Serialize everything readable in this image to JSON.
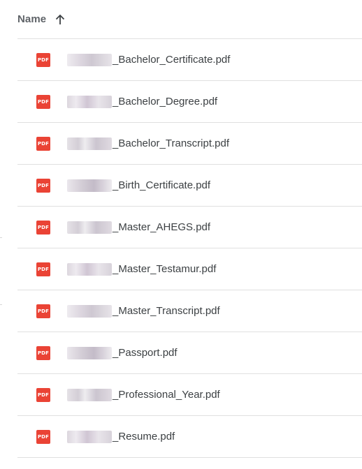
{
  "header": {
    "name_label": "Name",
    "sort_icon": "arrow-up-icon"
  },
  "colors": {
    "pdf_icon": "#ea4335",
    "text": "#3c4043",
    "header_text": "#5f6368",
    "divider": "#e0e0e0"
  },
  "files": [
    {
      "name": "_Bachelor_Certificate.pdf",
      "icon": "pdf-icon",
      "icon_text": "PDF"
    },
    {
      "name": "_Bachelor_Degree.pdf",
      "icon": "pdf-icon",
      "icon_text": "PDF"
    },
    {
      "name": "_Bachelor_Transcript.pdf",
      "icon": "pdf-icon",
      "icon_text": "PDF"
    },
    {
      "name": "_Birth_Certificate.pdf",
      "icon": "pdf-icon",
      "icon_text": "PDF"
    },
    {
      "name": "_Master_AHEGS.pdf",
      "icon": "pdf-icon",
      "icon_text": "PDF"
    },
    {
      "name": "_Master_Testamur.pdf",
      "icon": "pdf-icon",
      "icon_text": "PDF"
    },
    {
      "name": "_Master_Transcript.pdf",
      "icon": "pdf-icon",
      "icon_text": "PDF"
    },
    {
      "name": "_Passport.pdf",
      "icon": "pdf-icon",
      "icon_text": "PDF"
    },
    {
      "name": "_Professional_Year.pdf",
      "icon": "pdf-icon",
      "icon_text": "PDF"
    },
    {
      "name": "_Resume.pdf",
      "icon": "pdf-icon",
      "icon_text": "PDF"
    }
  ]
}
